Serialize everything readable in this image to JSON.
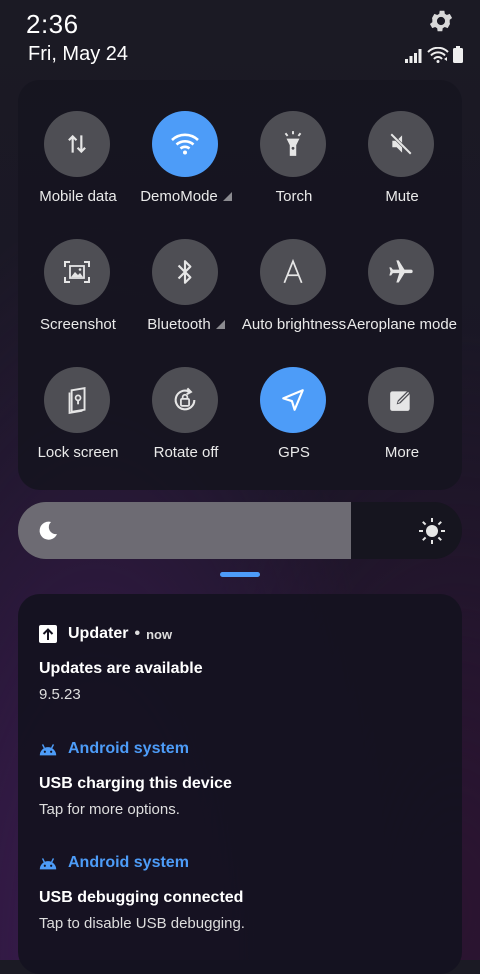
{
  "status_bar": {
    "time": "2:36",
    "date": "Fri, May 24"
  },
  "quick_settings": {
    "tiles": [
      {
        "label": "Mobile data",
        "icon": "mobile-data-icon",
        "active": false
      },
      {
        "label": "DemoMode",
        "icon": "wifi-icon",
        "active": true,
        "expandable": true
      },
      {
        "label": "Torch",
        "icon": "torch-icon",
        "active": false
      },
      {
        "label": "Mute",
        "icon": "mute-icon",
        "active": false
      },
      {
        "label": "Screenshot",
        "icon": "screenshot-icon",
        "active": false
      },
      {
        "label": "Bluetooth",
        "icon": "bluetooth-icon",
        "active": false,
        "expandable": true
      },
      {
        "label": "Auto brightness",
        "icon": "auto-brightness-icon",
        "active": false
      },
      {
        "label": "Aeroplane mode",
        "icon": "airplane-icon",
        "active": false
      },
      {
        "label": "Lock screen",
        "icon": "lock-screen-icon",
        "active": false
      },
      {
        "label": "Rotate off",
        "icon": "rotate-icon",
        "active": false
      },
      {
        "label": "GPS",
        "icon": "gps-icon",
        "active": true
      },
      {
        "label": "More",
        "icon": "edit-icon",
        "active": false
      }
    ],
    "brightness_level": 0.75
  },
  "notifications": [
    {
      "app": "Updater",
      "time": "now",
      "title": "Updates are available",
      "body": "9.5.23"
    },
    {
      "app": "Android system",
      "title": "USB charging this device",
      "body": "Tap for more options."
    },
    {
      "app": "Android system",
      "title": "USB debugging connected",
      "body": "Tap to disable USB debugging."
    }
  ],
  "colors": {
    "accent": "#4d9cf8",
    "tile_inactive": "#4e4e54",
    "panel_bg": "#16151f"
  }
}
